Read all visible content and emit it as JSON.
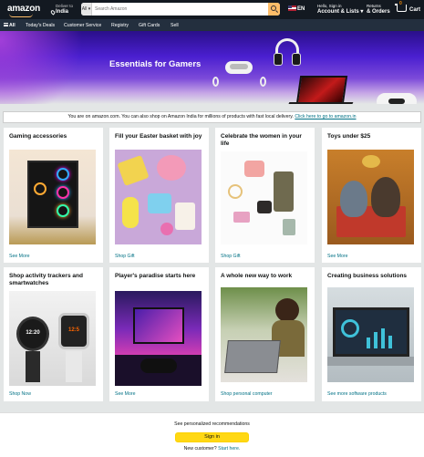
{
  "nav": {
    "logo": "amazon",
    "deliver_line1": "Deliver to",
    "deliver_line2": "India",
    "search_category": "All",
    "search_placeholder": "Search Amazon",
    "language": "EN",
    "account_line1": "Hello, Sign in",
    "account_line2": "Account & Lists",
    "returns_line1": "Returns",
    "returns_line2": "& Orders",
    "cart_count": "0",
    "cart_label": "Cart"
  },
  "subnav": {
    "all": "All",
    "items": [
      "Today's Deals",
      "Customer Service",
      "Registry",
      "Gift Cards",
      "Sell"
    ]
  },
  "hero": {
    "title": "Essentials for Gamers"
  },
  "notice": {
    "text": "You are on amazon.com. You can also shop on Amazon India for millions of products with fast local delivery.",
    "link": "Click here to go to amazon.in"
  },
  "cards": [
    {
      "title": "Gaming accessories",
      "link": "See More"
    },
    {
      "title": "Fill your Easter basket with joy",
      "link": "Shop Gift"
    },
    {
      "title": "Celebrate the women in your life",
      "link": "Shop Gift"
    },
    {
      "title": "Toys under $25",
      "link": "See More"
    },
    {
      "title": "Shop activity trackers and smartwatches",
      "link": "Shop Now"
    },
    {
      "title": "Player's paradise starts here",
      "link": "See More"
    },
    {
      "title": "A whole new way to work",
      "link": "Shop personal computer"
    },
    {
      "title": "Creating business solutions",
      "link": "See more software products"
    }
  ],
  "footer": {
    "recommend": "See personalized recommendations",
    "signin": "Sign in",
    "new_customer": "New customer?",
    "start_here": "Start here."
  },
  "watch_time_1": "12:20",
  "watch_time_2": "12:5"
}
